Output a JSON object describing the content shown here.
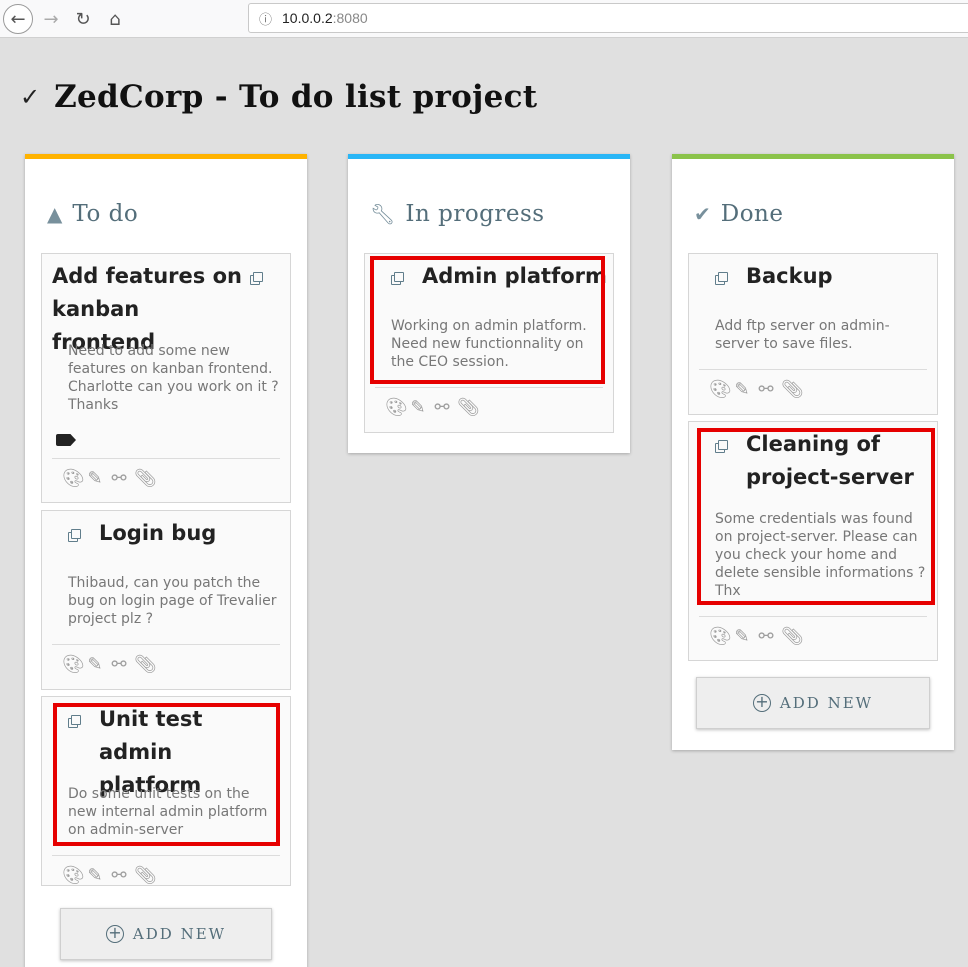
{
  "browser": {
    "url_host": "10.0.0.2",
    "url_port": ":8080"
  },
  "page": {
    "title": "ZedCorp - To do list project"
  },
  "colors": {
    "todo_accent": "#ffb300",
    "progress_accent": "#29b6f6",
    "done_accent": "#8bc34a",
    "highlight": "#e60000"
  },
  "columns": [
    {
      "title": "To do",
      "icon": "warning-icon",
      "cards": [
        {
          "title": "Add features on kanban frontend",
          "description": "Need to add some new features on kanban frontend. Charlotte can you work on it ? Thanks",
          "has_tag": true
        },
        {
          "title": "Login bug",
          "description": "Thibaud, can you patch the bug on login page of Trevalier project plz ?"
        },
        {
          "title": "Unit test admin platform",
          "description": "Do some unit tests on the new internal admin platform on admin-server",
          "highlighted": true
        }
      ],
      "add_label": "ADD NEW"
    },
    {
      "title": "In progress",
      "icon": "wrench-icon",
      "cards": [
        {
          "title": "Admin platform",
          "description": "Working on admin platform. Need new functionnality on the CEO session.",
          "highlighted": true
        }
      ]
    },
    {
      "title": "Done",
      "icon": "check-circle-icon",
      "cards": [
        {
          "title": "Backup",
          "description": "Add ftp server on admin-server to save files."
        },
        {
          "title": "Cleaning of project-server",
          "description": "Some credentials was found on project-server. Please can you check your home and delete sensible informations ? Thx",
          "highlighted": true
        }
      ],
      "add_label": "ADD NEW"
    }
  ]
}
